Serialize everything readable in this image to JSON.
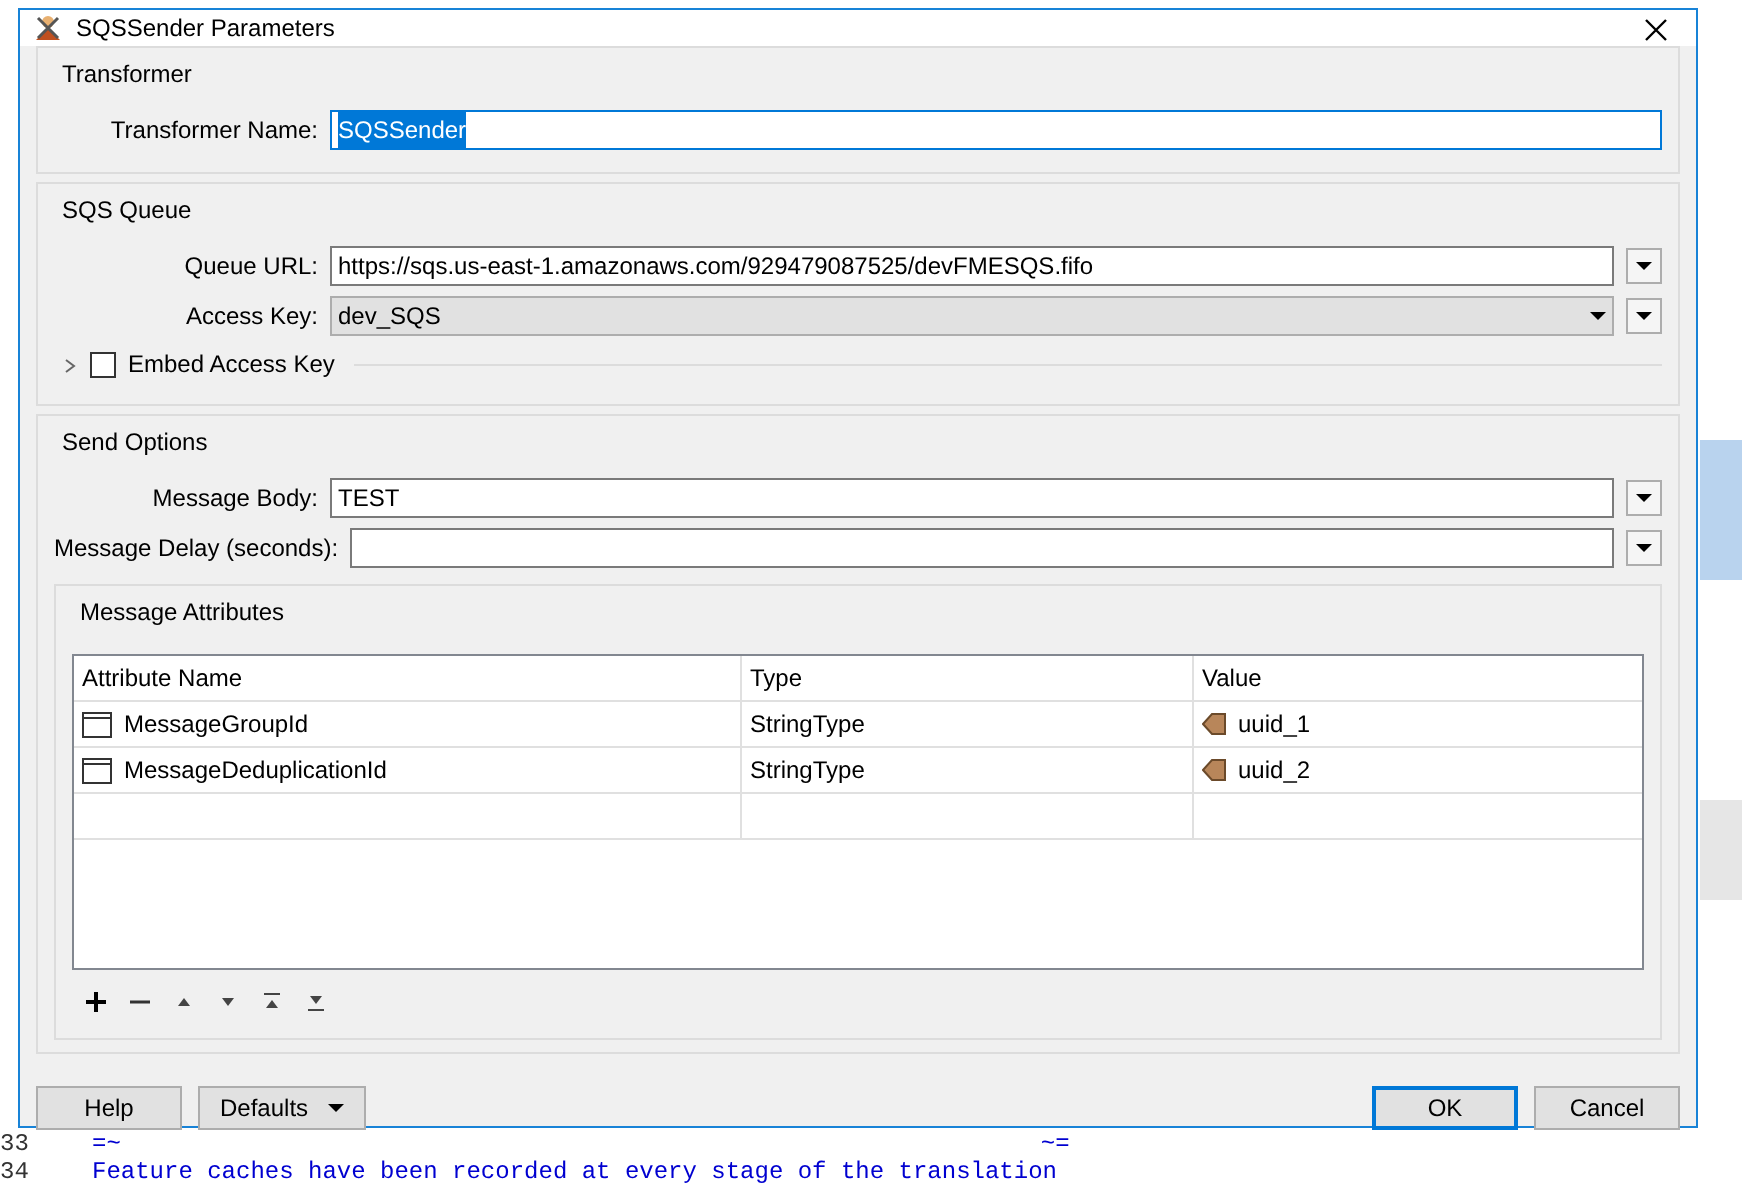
{
  "window": {
    "title": "SQSSender Parameters"
  },
  "transformer": {
    "heading": "Transformer",
    "label": "Transformer Name:",
    "value": "SQSSender"
  },
  "sqs_queue": {
    "heading": "SQS Queue",
    "fields": [
      {
        "label": "Queue URL:",
        "value": "https://sqs.us-east-1.amazonaws.com/929479087525/devFMESQS.fifo",
        "kind": "text"
      },
      {
        "label": "Access Key:",
        "value": "dev_SQS",
        "kind": "select"
      }
    ],
    "embed": {
      "label": "Embed Access Key",
      "checked": false,
      "expanded": false
    }
  },
  "send_options": {
    "heading": "Send Options",
    "fields": [
      {
        "label": "Message Body:",
        "value": "TEST"
      },
      {
        "label": "Message Delay (seconds):"
      }
    ],
    "attributes": {
      "heading": "Message Attributes",
      "columns": [
        "Attribute Name",
        "Type",
        "Value"
      ],
      "rows": [
        {
          "name": "MessageGroupId",
          "type": "StringType",
          "value": "uuid_1"
        },
        {
          "name": "MessageDeduplicationId",
          "type": "StringType",
          "value": "uuid_2"
        }
      ]
    }
  },
  "buttons": {
    "help": "Help",
    "defaults": "Defaults",
    "ok": "OK",
    "cancel": "Cancel"
  },
  "log": [
    {
      "line": "33",
      "text": "=~",
      "end": "~="
    },
    {
      "line": "34",
      "text": "Feature caches have been recorded at every stage of the translation"
    }
  ]
}
